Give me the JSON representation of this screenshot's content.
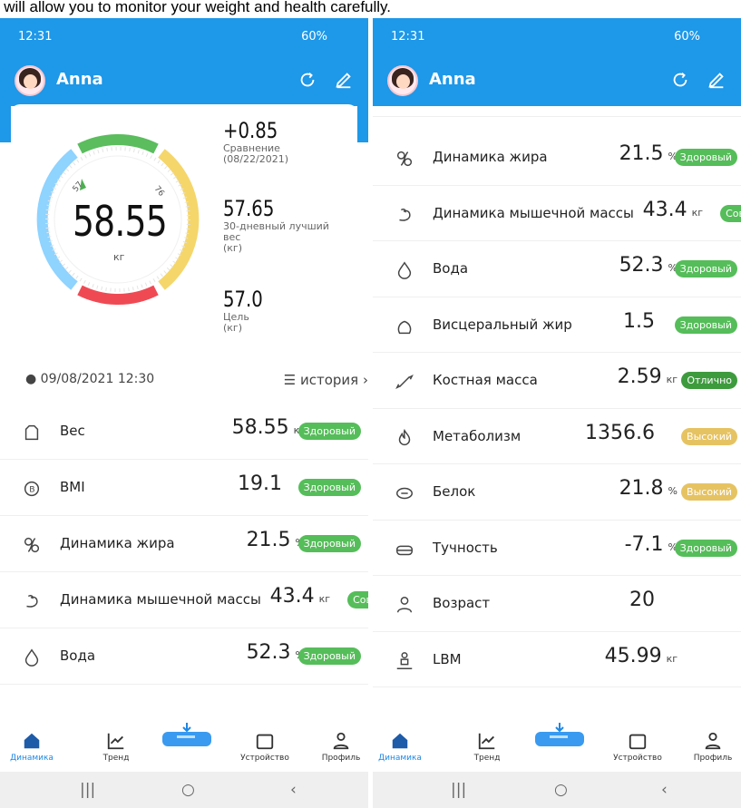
{
  "caption": "s will allow you to monitor your weight and health carefully.",
  "colors": {
    "header": "#1e98e8",
    "healthy": "#55bd59",
    "excellent": "#3d9b3e",
    "high": "#e6c362",
    "gauge_blue": "#8fd3ff",
    "gauge_green": "#5bbd5e",
    "gauge_yellow": "#f5d66a",
    "gauge_red": "#ef4a54"
  },
  "left": {
    "status": {
      "time": "12:31",
      "battery": "60%"
    },
    "user": "Anna",
    "summary": {
      "weight": "58.55",
      "unit": "кг",
      "gauge_marks": [
        "57",
        "76"
      ],
      "compare_value": "+0.85",
      "compare_label": "Сравнение",
      "compare_date": "(08/22/2021)",
      "best_value": "57.65",
      "best_label1": "30-дневный лучший",
      "best_label2": "вес",
      "best_label3": "(кг)",
      "goal_value": "57.0",
      "goal_label": "Цель",
      "goal_unit": "(кг)"
    },
    "datetime": "09/08/2021 12:30",
    "history": "история",
    "rows": [
      {
        "name": "Вес",
        "value": "58.55",
        "unit": "кг",
        "badge": "Здоровый",
        "icon": "weight-icon"
      },
      {
        "name": "BMI",
        "value": "19.1",
        "unit": "",
        "badge": "Здоровый",
        "icon": "bmi-icon"
      },
      {
        "name": "Динамика жира",
        "value": "21.5",
        "unit": "%",
        "badge": "Здоровый",
        "icon": "fat-icon"
      },
      {
        "name": "Динамика мышечной массы",
        "value": "43.4",
        "unit": "кг",
        "badge": "Сов",
        "icon": "muscle-icon"
      },
      {
        "name": "Вода",
        "value": "52.3",
        "unit": "%",
        "badge": "Здоровый",
        "icon": "water-icon"
      }
    ]
  },
  "right": {
    "status": {
      "time": "12:31",
      "battery": "60%"
    },
    "user": "Anna",
    "rows": [
      {
        "name": "Динамика жира",
        "value": "21.5",
        "unit": "%",
        "badge": "Здоровый",
        "icon": "fat-icon"
      },
      {
        "name": "Динамика мышечной массы",
        "value": "43.4",
        "unit": "кг",
        "badge": "Сов",
        "icon": "muscle-icon"
      },
      {
        "name": "Вода",
        "value": "52.3",
        "unit": "%",
        "badge": "Здоровый",
        "icon": "water-icon"
      },
      {
        "name": "Висцеральный жир",
        "value": "1.5",
        "unit": "",
        "badge": "Здоровый",
        "icon": "visceral-fat-icon"
      },
      {
        "name": "Костная масса",
        "value": "2.59",
        "unit": "кг",
        "badge": "Отлично",
        "icon": "bone-icon"
      },
      {
        "name": "Метаболизм",
        "value": "1356.6",
        "unit": "",
        "badge": "Высокий",
        "icon": "metabolism-icon"
      },
      {
        "name": "Белок",
        "value": "21.8",
        "unit": "%",
        "badge": "Высокий",
        "icon": "protein-icon"
      },
      {
        "name": "Тучность",
        "value": "-7.1",
        "unit": "%",
        "badge": "Здоровый",
        "icon": "obesity-icon"
      },
      {
        "name": "Возраст",
        "value": "20",
        "unit": "",
        "badge": "",
        "icon": "age-icon"
      },
      {
        "name": "LBM",
        "value": "45.99",
        "unit": "кг",
        "badge": "",
        "icon": "lbm-icon"
      }
    ]
  },
  "nav": [
    "Динамика",
    "Тренд",
    "Устройство",
    "Профиль"
  ]
}
